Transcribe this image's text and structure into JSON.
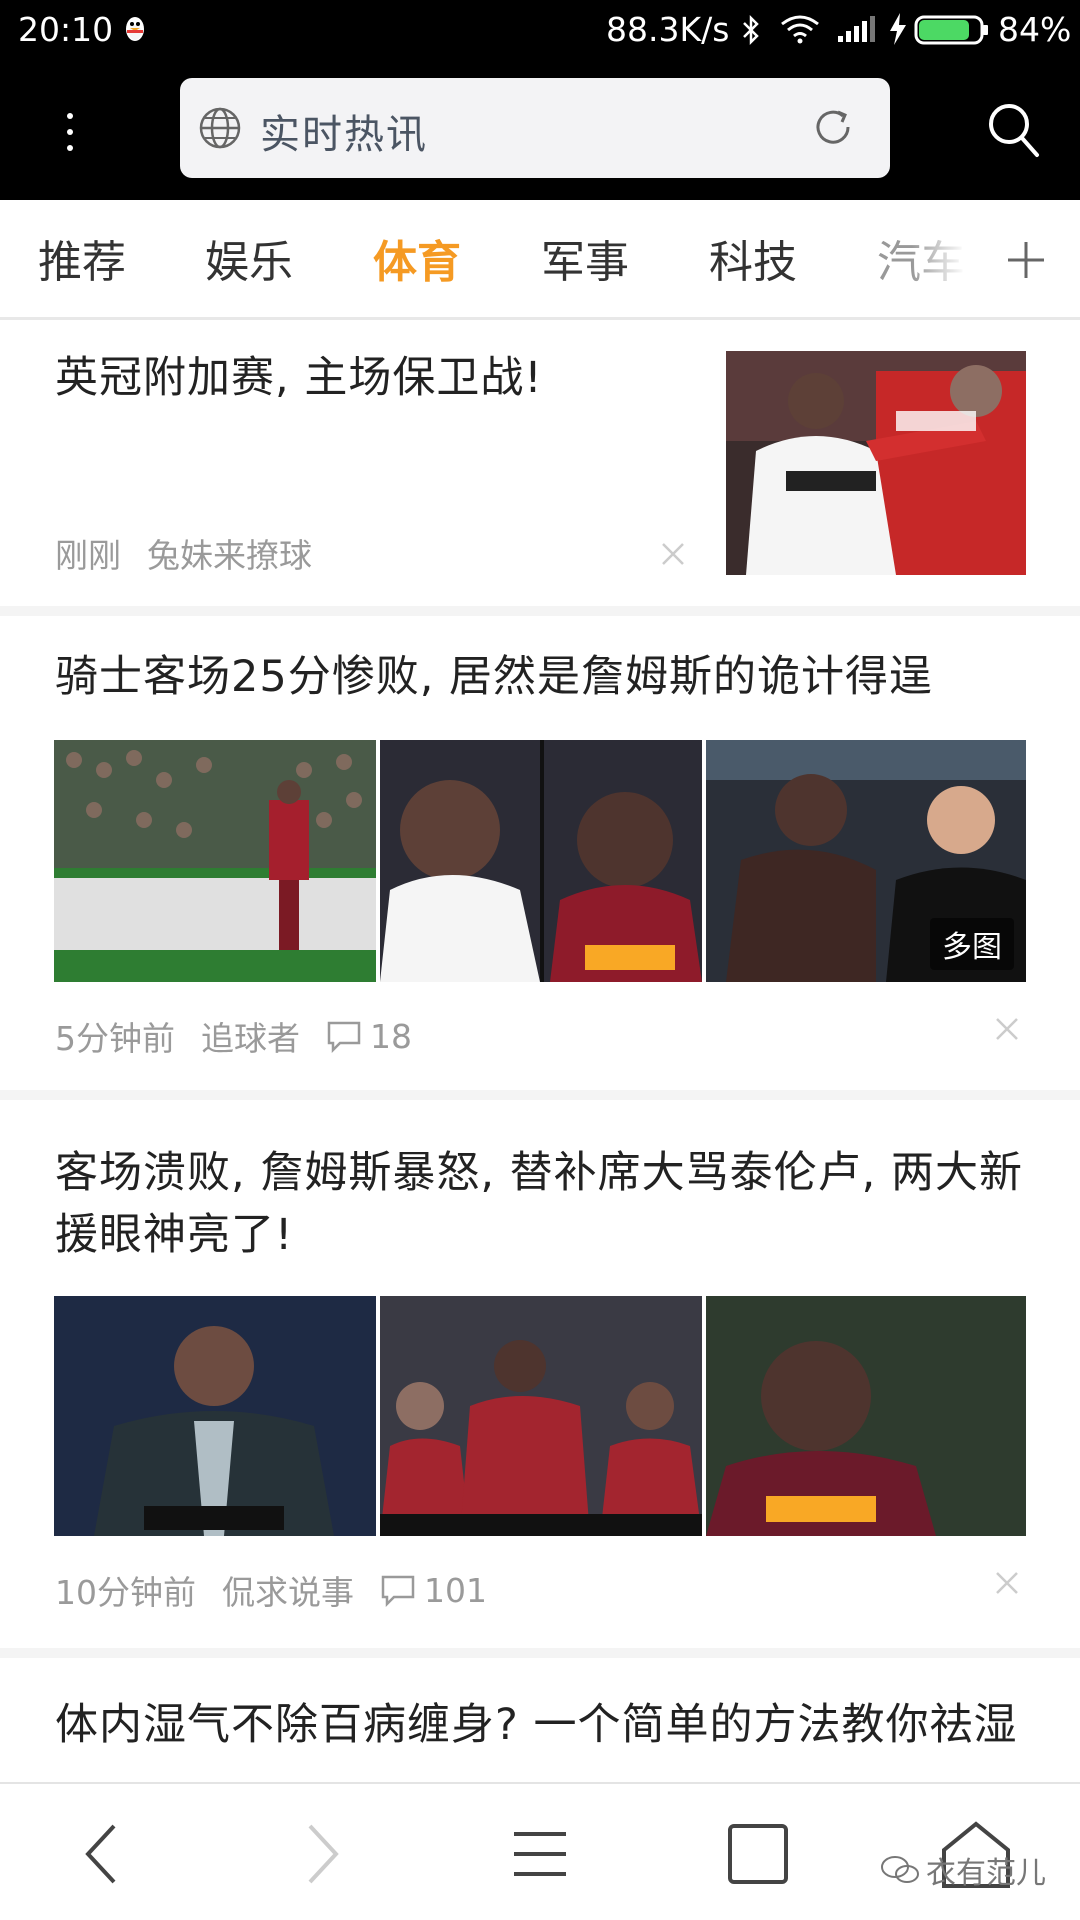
{
  "status_bar": {
    "time": "20:10",
    "net_speed": "88.3K/s",
    "battery_percent": "84%",
    "battery_level": 0.84,
    "battery_color": "#4cd964"
  },
  "toolbar": {
    "url_text": "实时热讯"
  },
  "tabs": [
    {
      "label": "推荐"
    },
    {
      "label": "娱乐"
    },
    {
      "label": "体育",
      "active": true
    },
    {
      "label": "军事"
    },
    {
      "label": "科技"
    },
    {
      "label": "汽车"
    }
  ],
  "accent_color": "#f59a23",
  "feed": [
    {
      "title": "英冠附加赛, 主场保卫战!",
      "time": "刚刚",
      "source": "兔妹来撩球"
    },
    {
      "title": "骑士客场25分惨败, 居然是詹姆斯的诡计得逞",
      "time": "5分钟前",
      "source": "追球者",
      "comments": "18",
      "badge": "多图"
    },
    {
      "title": "客场溃败, 詹姆斯暴怒, 替补席大骂泰伦卢, 两大新援眼神亮了!",
      "time": "10分钟前",
      "source": "侃求说事",
      "comments": "101"
    },
    {
      "title": "体内湿气不除百病缠身? 一个简单的方法教你祛湿"
    }
  ],
  "watermark": "衣有范儿"
}
